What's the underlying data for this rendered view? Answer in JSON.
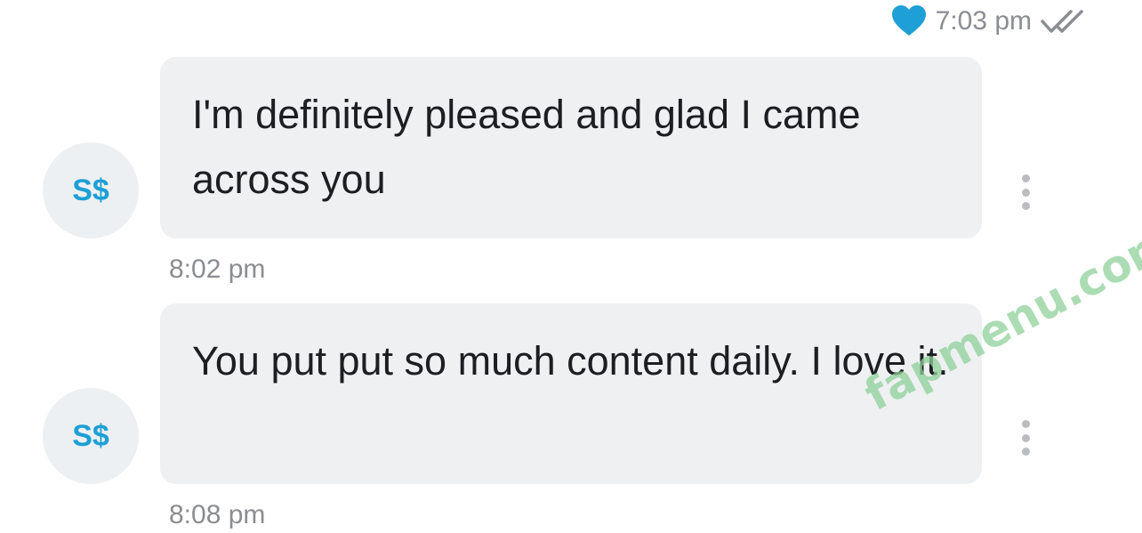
{
  "header": {
    "time": "7:03 pm",
    "icons": [
      "heart-icon",
      "double-check-icon"
    ]
  },
  "colors": {
    "accent": "#1e9fd6",
    "bubble": "#eef0f2",
    "avatar_bg": "#edf0f2",
    "muted_text": "#8a8d91"
  },
  "messages": [
    {
      "avatar": "S$",
      "text": "I'm definitely pleased and glad I came across you",
      "time": "8:02 pm"
    },
    {
      "avatar": "S$",
      "text": "You put put so much content daily. I love it.",
      "time": "8:08 pm"
    }
  ],
  "watermark": "fapmenu.com"
}
